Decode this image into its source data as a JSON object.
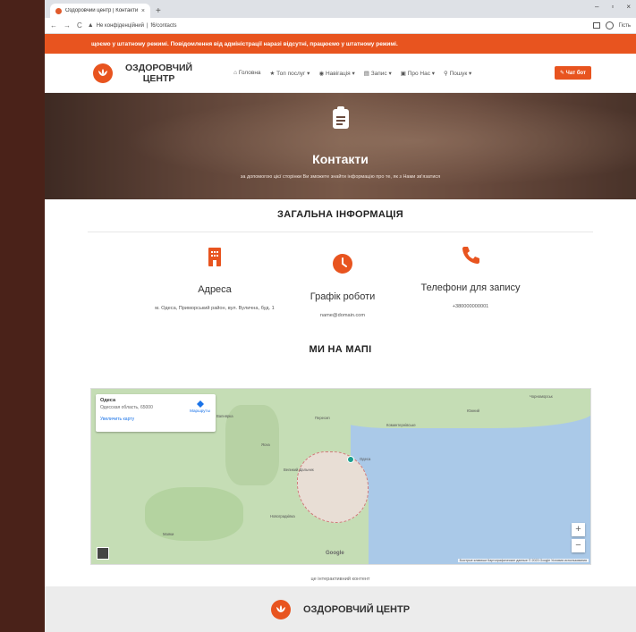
{
  "browser": {
    "tab_title": "Оздоровчий центр | Контакти",
    "tab_close": "×",
    "new_tab": "+",
    "back": "←",
    "forward": "→",
    "reload": "C",
    "warn": "▲",
    "security": "Не конфіденційний",
    "url": "f6/contacts",
    "profile": "Гість",
    "win_min": "–",
    "win_max": "▫",
    "win_close": "×"
  },
  "notice": "щоємо у штатному режимі.    Повідомлення від адміністрації наразі відсутні, працюємо у штатному режимі.",
  "header": {
    "logo_line1": "ОЗДОРОВЧИЙ",
    "logo_line2": "ЦЕНТР",
    "menu": [
      {
        "label": "Головна"
      },
      {
        "label": "Топ послуг ▾"
      },
      {
        "label": "Навігація ▾"
      },
      {
        "label": "Запис ▾"
      },
      {
        "label": "Про Нас ▾"
      },
      {
        "label": "Пошук ▾"
      }
    ],
    "chat_button": "Чат бот"
  },
  "hero": {
    "title": "Контакти",
    "subtitle": "за допомогою цієї сторінки Ви зможете знайти інформацію про те, як з Нами зв'язатися"
  },
  "general": {
    "title": "ЗАГАЛЬНА ІНФОРМАЦІЯ",
    "address_head": "Адреса",
    "address_value": "м. Одеса, Приморський район, вул. Вулична, буд. 1",
    "schedule_head": "Графік роботи",
    "schedule_value": "name@domain.com",
    "phone_head": "Телефони для запису",
    "phone_value": "+380000000001"
  },
  "map": {
    "title": "МИ НА МАПІ",
    "card_city": "Одеса",
    "card_region": "Одесская область, 65000",
    "card_enlarge": "Увеличить карту",
    "card_route": "Маршруты",
    "zoom_in": "+",
    "zoom_out": "−",
    "google": "Google",
    "footer": "Быстрые клавиши   Картографические данные © 2023 Google   Условия использования",
    "labels": [
      "Одеса",
      "Пересип",
      "Маяки",
      "Вапнярка",
      "Южний",
      "Великий Дальник",
      "Новоградківка",
      "Коминтернівське",
      "Чорноморськ",
      "Ясна"
    ]
  },
  "caption": "це інтерактивний контент",
  "footer_brand": "ОЗДОРОВЧИЙ ЦЕНТР"
}
